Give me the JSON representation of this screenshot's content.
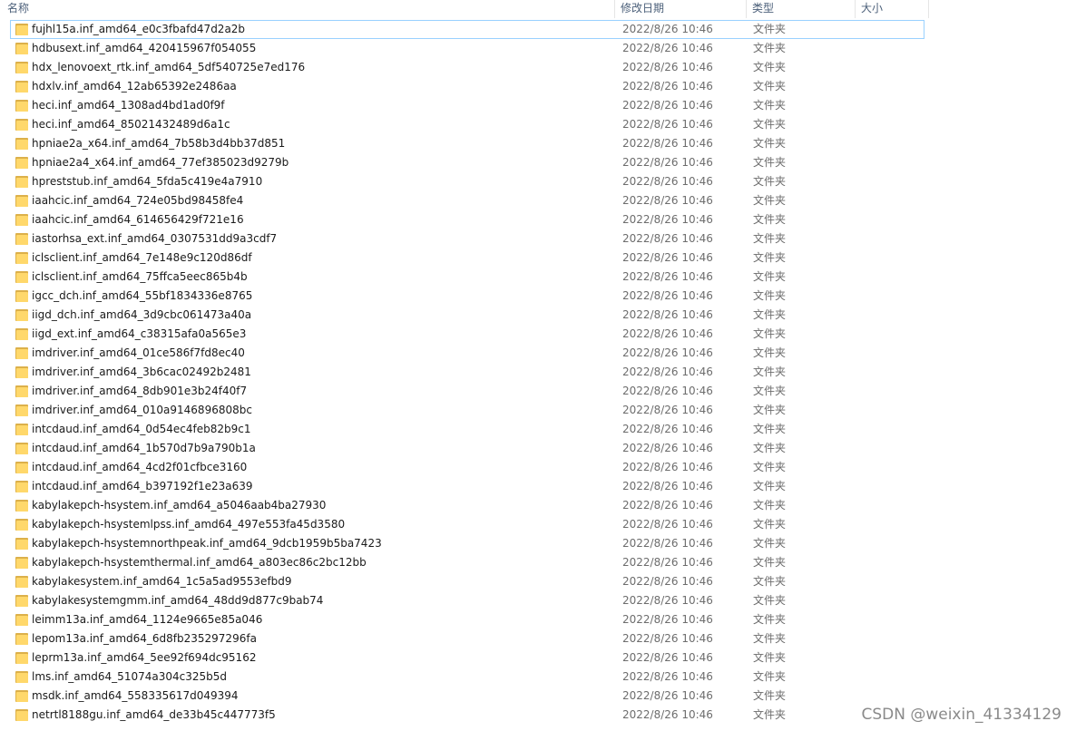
{
  "columns": {
    "name": "名称",
    "date": "修改日期",
    "type": "类型",
    "size": "大小"
  },
  "files": [
    {
      "name": "fujhl15a.inf_amd64_e0c3fbafd47d2a2b",
      "date": "2022/8/26 10:46",
      "type": "文件夹"
    },
    {
      "name": "hdbusext.inf_amd64_420415967f054055",
      "date": "2022/8/26 10:46",
      "type": "文件夹"
    },
    {
      "name": "hdx_lenovoext_rtk.inf_amd64_5df540725e7ed176",
      "date": "2022/8/26 10:46",
      "type": "文件夹"
    },
    {
      "name": "hdxlv.inf_amd64_12ab65392e2486aa",
      "date": "2022/8/26 10:46",
      "type": "文件夹"
    },
    {
      "name": "heci.inf_amd64_1308ad4bd1ad0f9f",
      "date": "2022/8/26 10:46",
      "type": "文件夹"
    },
    {
      "name": "heci.inf_amd64_85021432489d6a1c",
      "date": "2022/8/26 10:46",
      "type": "文件夹"
    },
    {
      "name": "hpniae2a_x64.inf_amd64_7b58b3d4bb37d851",
      "date": "2022/8/26 10:46",
      "type": "文件夹"
    },
    {
      "name": "hpniae2a4_x64.inf_amd64_77ef385023d9279b",
      "date": "2022/8/26 10:46",
      "type": "文件夹"
    },
    {
      "name": "hpreststub.inf_amd64_5fda5c419e4a7910",
      "date": "2022/8/26 10:46",
      "type": "文件夹"
    },
    {
      "name": "iaahcic.inf_amd64_724e05bd98458fe4",
      "date": "2022/8/26 10:46",
      "type": "文件夹"
    },
    {
      "name": "iaahcic.inf_amd64_614656429f721e16",
      "date": "2022/8/26 10:46",
      "type": "文件夹"
    },
    {
      "name": "iastorhsa_ext.inf_amd64_0307531dd9a3cdf7",
      "date": "2022/8/26 10:46",
      "type": "文件夹"
    },
    {
      "name": "iclsclient.inf_amd64_7e148e9c120d86df",
      "date": "2022/8/26 10:46",
      "type": "文件夹"
    },
    {
      "name": "iclsclient.inf_amd64_75ffca5eec865b4b",
      "date": "2022/8/26 10:46",
      "type": "文件夹"
    },
    {
      "name": "igcc_dch.inf_amd64_55bf1834336e8765",
      "date": "2022/8/26 10:46",
      "type": "文件夹"
    },
    {
      "name": "iigd_dch.inf_amd64_3d9cbc061473a40a",
      "date": "2022/8/26 10:46",
      "type": "文件夹"
    },
    {
      "name": "iigd_ext.inf_amd64_c38315afa0a565e3",
      "date": "2022/8/26 10:46",
      "type": "文件夹"
    },
    {
      "name": "imdriver.inf_amd64_01ce586f7fd8ec40",
      "date": "2022/8/26 10:46",
      "type": "文件夹"
    },
    {
      "name": "imdriver.inf_amd64_3b6cac02492b2481",
      "date": "2022/8/26 10:46",
      "type": "文件夹"
    },
    {
      "name": "imdriver.inf_amd64_8db901e3b24f40f7",
      "date": "2022/8/26 10:46",
      "type": "文件夹"
    },
    {
      "name": "imdriver.inf_amd64_010a9146896808bc",
      "date": "2022/8/26 10:46",
      "type": "文件夹"
    },
    {
      "name": "intcdaud.inf_amd64_0d54ec4feb82b9c1",
      "date": "2022/8/26 10:46",
      "type": "文件夹"
    },
    {
      "name": "intcdaud.inf_amd64_1b570d7b9a790b1a",
      "date": "2022/8/26 10:46",
      "type": "文件夹"
    },
    {
      "name": "intcdaud.inf_amd64_4cd2f01cfbce3160",
      "date": "2022/8/26 10:46",
      "type": "文件夹"
    },
    {
      "name": "intcdaud.inf_amd64_b397192f1e23a639",
      "date": "2022/8/26 10:46",
      "type": "文件夹"
    },
    {
      "name": "kabylakepch-hsystem.inf_amd64_a5046aab4ba27930",
      "date": "2022/8/26 10:46",
      "type": "文件夹"
    },
    {
      "name": "kabylakepch-hsystemlpss.inf_amd64_497e553fa45d3580",
      "date": "2022/8/26 10:46",
      "type": "文件夹"
    },
    {
      "name": "kabylakepch-hsystemnorthpeak.inf_amd64_9dcb1959b5ba7423",
      "date": "2022/8/26 10:46",
      "type": "文件夹"
    },
    {
      "name": "kabylakepch-hsystemthermal.inf_amd64_a803ec86c2bc12bb",
      "date": "2022/8/26 10:46",
      "type": "文件夹"
    },
    {
      "name": "kabylakesystem.inf_amd64_1c5a5ad9553efbd9",
      "date": "2022/8/26 10:46",
      "type": "文件夹"
    },
    {
      "name": "kabylakesystemgmm.inf_amd64_48dd9d877c9bab74",
      "date": "2022/8/26 10:46",
      "type": "文件夹"
    },
    {
      "name": "leimm13a.inf_amd64_1124e9665e85a046",
      "date": "2022/8/26 10:46",
      "type": "文件夹"
    },
    {
      "name": "lepom13a.inf_amd64_6d8fb235297296fa",
      "date": "2022/8/26 10:46",
      "type": "文件夹"
    },
    {
      "name": "leprm13a.inf_amd64_5ee92f694dc95162",
      "date": "2022/8/26 10:46",
      "type": "文件夹"
    },
    {
      "name": "lms.inf_amd64_51074a304c325b5d",
      "date": "2022/8/26 10:46",
      "type": "文件夹"
    },
    {
      "name": "msdk.inf_amd64_558335617d049394",
      "date": "2022/8/26 10:46",
      "type": "文件夹"
    },
    {
      "name": "netrtl8188gu.inf_amd64_de33b45c447773f5",
      "date": "2022/8/26 10:46",
      "type": "文件夹"
    }
  ],
  "watermark": "CSDN @weixin_41334129",
  "colors": {
    "selection_border": "#99d1ff",
    "header_text": "#4c607a",
    "folder": "#ffd86b"
  }
}
